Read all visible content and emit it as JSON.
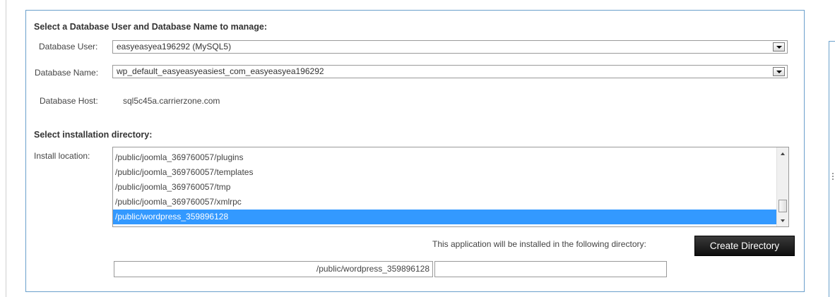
{
  "db_section": {
    "title": "Select a Database User and Database Name to manage:",
    "user_label": "Database User:",
    "user_value": "easyeasyea196292 (MySQL5)",
    "name_label": "Database Name:",
    "name_value": "wp_default_easyeasyeasiest_com_easyeasyea196292",
    "host_label": "Database Host:",
    "host_value": "sql5c45a.carrierzone.com"
  },
  "install_section": {
    "title": "Select installation directory:",
    "location_label": "Install location:",
    "directories": [
      "/public/joomla_369760057/plugins",
      "/public/joomla_369760057/templates",
      "/public/joomla_369760057/tmp",
      "/public/joomla_369760057/xmlrpc",
      "/public/wordpress_359896128"
    ],
    "selected_index": 4,
    "info_text": "This application will be installed in the following directory:",
    "create_button": "Create Directory",
    "path_value": "/public/wordpress_359896128",
    "subdir_value": ""
  },
  "colors": {
    "panel_border": "#6aa0cc",
    "selection": "#3399ff",
    "button_bg": "#1a1a1a"
  }
}
